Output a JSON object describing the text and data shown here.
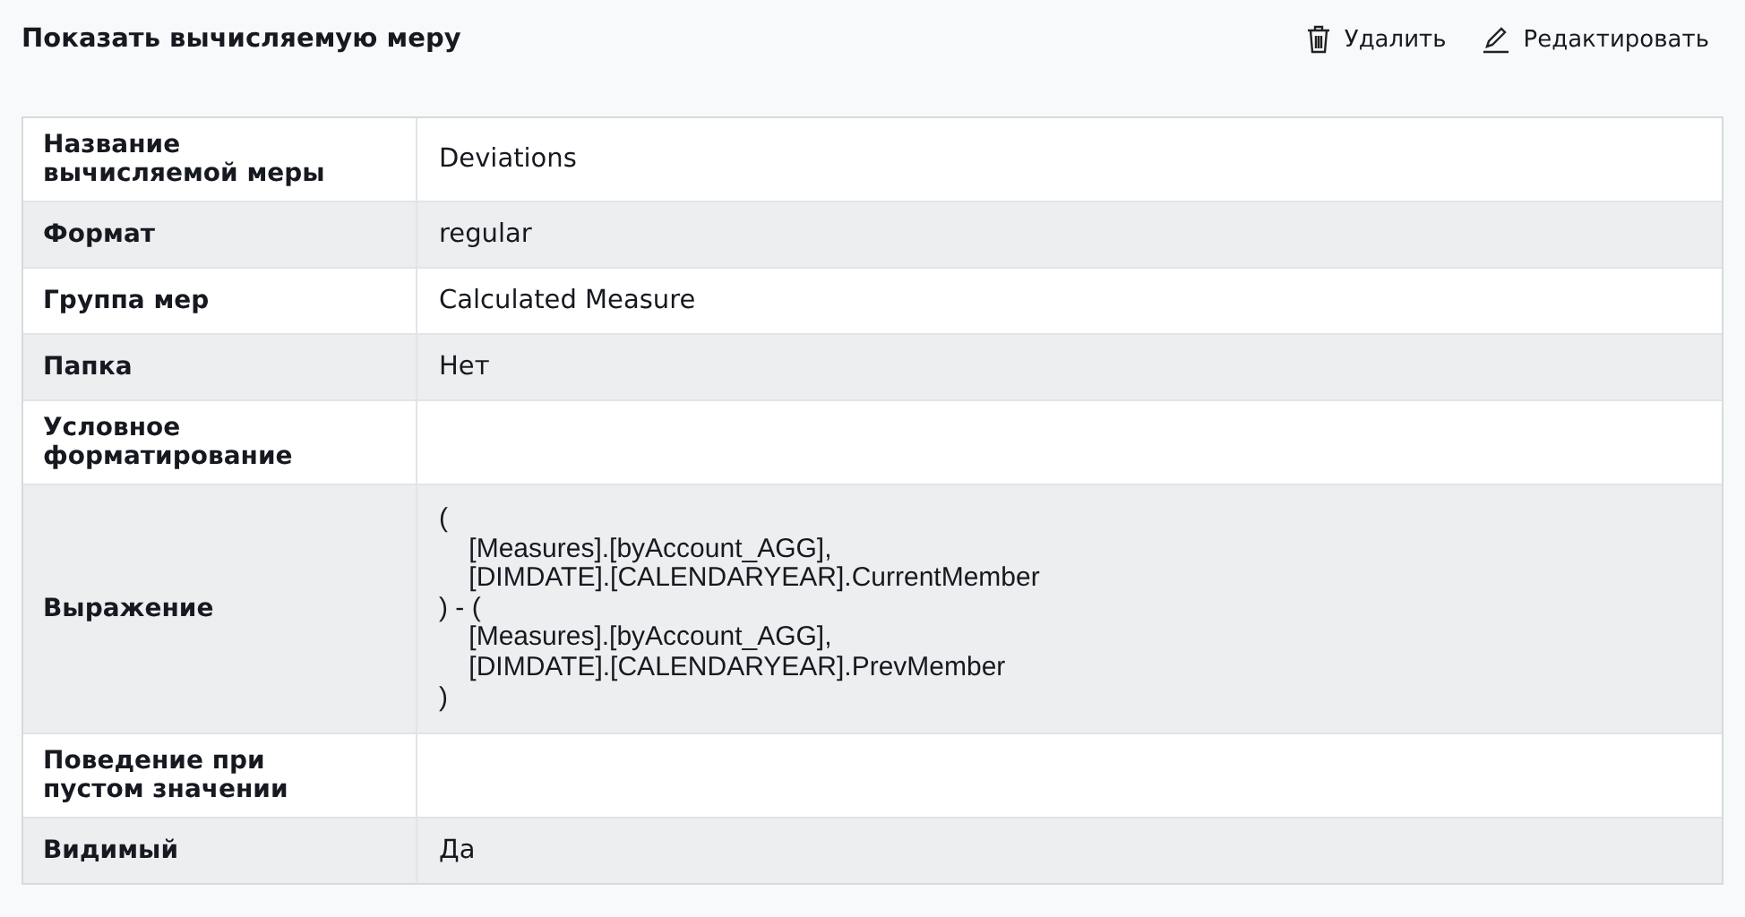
{
  "title": "Показать вычисляемую меру",
  "actions": [
    {
      "kind": "delete",
      "label": "Удалить"
    },
    {
      "kind": "edit",
      "label": "Редактировать"
    }
  ],
  "rows": [
    {
      "label": "Название вычисляемой меры",
      "value": "Deviations"
    },
    {
      "label": "Формат",
      "value": "regular"
    },
    {
      "label": "Группа мер",
      "value": "Calculated Measure"
    },
    {
      "label": "Папка",
      "value": "Нет"
    },
    {
      "label": "Условное форматирование",
      "value": ""
    },
    {
      "label": "Выражение",
      "kind": "code",
      "value": "(\n    [Measures].[byAccount_AGG],\n    [DIMDATE].[CALENDARYEAR].CurrentMember\n) - (\n    [Measures].[byAccount_AGG],\n    [DIMDATE].[CALENDARYEAR].PrevMember\n)"
    },
    {
      "label": "Поведение при пустом значении",
      "value": ""
    },
    {
      "label": "Видимый",
      "value": "Да"
    }
  ]
}
